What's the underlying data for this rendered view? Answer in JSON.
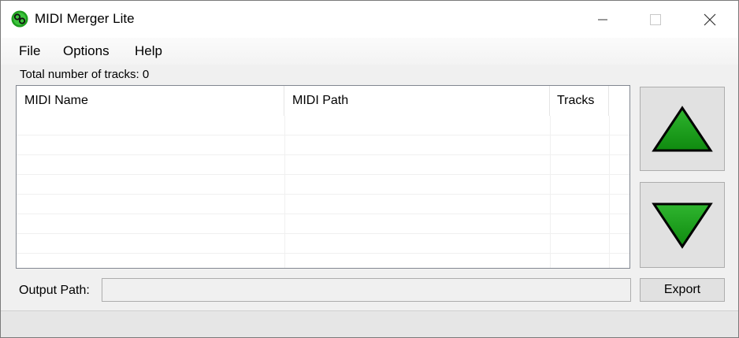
{
  "window": {
    "title": "MIDI Merger Lite",
    "icon": "midi-merger-app-icon"
  },
  "window_controls": {
    "minimize_icon": "minimize-icon",
    "maximize_icon": "maximize-icon",
    "close_icon": "close-icon"
  },
  "menu": {
    "items": [
      {
        "label": "File"
      },
      {
        "label": "Options"
      },
      {
        "label": "Help"
      }
    ]
  },
  "track_count": {
    "text": "Total number of tracks: 0"
  },
  "list": {
    "columns": [
      {
        "label": "MIDI Name"
      },
      {
        "label": "MIDI Path"
      },
      {
        "label": "Tracks"
      }
    ],
    "rows": []
  },
  "side_buttons": {
    "up_icon": "move-up-arrow-icon",
    "down_icon": "move-down-arrow-icon",
    "arrow_color": "#22a322",
    "arrow_outline": "#000000"
  },
  "output": {
    "label": "Output Path:",
    "value": "",
    "export_label": "Export"
  }
}
